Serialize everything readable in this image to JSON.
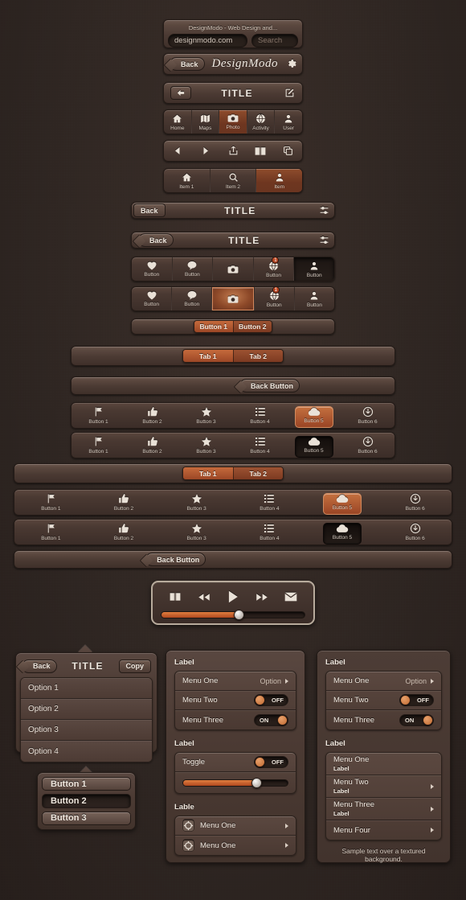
{
  "palette": {
    "background": "#2e2420",
    "bar_light": "#6b574d",
    "bar_dark": "#3f302a",
    "accent_orange": "#b0512c",
    "text": "#e8e0d8",
    "pressed_dark": "#241c19"
  },
  "browser_bar": {
    "page_title": "DesignModo - Web Design  and...",
    "url_value": "designmodo.com",
    "search_placeholder": "Search"
  },
  "logo_bar": {
    "back_label": "Back",
    "logo_text": "DesignModo",
    "gear_icon": "gear-icon"
  },
  "title_bar": {
    "back_icon": "arrow-left-icon",
    "title": "TITLE",
    "compose_icon": "compose-icon"
  },
  "tabbar_five": {
    "items": [
      {
        "label": "Home",
        "icon": "home-icon",
        "active": false
      },
      {
        "label": "Maps",
        "icon": "map-icon",
        "active": false
      },
      {
        "label": "Photo",
        "icon": "camera-icon",
        "active": true
      },
      {
        "label": "Activity",
        "icon": "globe-icon",
        "active": false
      },
      {
        "label": "User",
        "icon": "person-icon",
        "active": false
      }
    ]
  },
  "toolbar_icons": {
    "items": [
      {
        "icon": "triangle-left-icon"
      },
      {
        "icon": "triangle-right-icon"
      },
      {
        "icon": "share-icon"
      },
      {
        "icon": "book-icon"
      },
      {
        "icon": "copy-icon"
      }
    ]
  },
  "item_bar": {
    "items": [
      {
        "label": "Item 1",
        "icon": "home-icon",
        "active": false
      },
      {
        "label": "Item 2",
        "icon": "search-icon",
        "active": false
      },
      {
        "label": "Item",
        "icon": "person-icon",
        "active": true
      }
    ]
  },
  "navbar_flat": {
    "back_label": "Back",
    "title": "TITLE",
    "right_icon": "sliders-icon"
  },
  "navbar_arrow": {
    "back_label": "Back",
    "title": "TITLE",
    "right_icon": "sliders-icon"
  },
  "buttonbar_a": {
    "items": [
      {
        "label": "Button",
        "icon": "heart-icon",
        "state": "normal",
        "badge": ""
      },
      {
        "label": "Button",
        "icon": "comment-icon",
        "state": "normal",
        "badge": ""
      },
      {
        "label": "",
        "icon": "camera-icon",
        "state": "normal",
        "badge": ""
      },
      {
        "label": "Button",
        "icon": "globe-icon",
        "state": "normal",
        "badge": "1"
      },
      {
        "label": "Button",
        "icon": "person-icon",
        "state": "pressed",
        "badge": ""
      }
    ]
  },
  "buttonbar_b": {
    "items": [
      {
        "label": "Button",
        "icon": "heart-icon",
        "state": "normal",
        "badge": ""
      },
      {
        "label": "Button",
        "icon": "comment-icon",
        "state": "normal",
        "badge": ""
      },
      {
        "label": "",
        "icon": "camera-icon",
        "state": "active",
        "badge": ""
      },
      {
        "label": "Button",
        "icon": "globe-icon",
        "state": "normal",
        "badge": "1"
      },
      {
        "label": "Button",
        "icon": "person-icon",
        "state": "normal",
        "badge": ""
      }
    ]
  },
  "segmented_small": {
    "options": [
      {
        "label": "Button 1",
        "selected": true
      },
      {
        "label": "Button 2",
        "selected": false
      }
    ]
  },
  "segmented_tabs_narrow": {
    "options": [
      {
        "label": "Tab 1",
        "selected": true
      },
      {
        "label": "Tab 2",
        "selected": false
      }
    ]
  },
  "segmented_tabs_wide": {
    "options": [
      {
        "label": "Tab 1",
        "selected": true
      },
      {
        "label": "Tab 2",
        "selected": false
      }
    ]
  },
  "back_button_bar_narrow": {
    "label": "Back Button"
  },
  "back_button_bar_wide": {
    "label": "Back Button"
  },
  "toolbar_six_a": {
    "items": [
      {
        "label": "Button 1",
        "icon": "flag-icon",
        "state": "normal"
      },
      {
        "label": "Button 2",
        "icon": "thumbs-up-icon",
        "state": "normal"
      },
      {
        "label": "Button 3",
        "icon": "star-icon",
        "state": "normal"
      },
      {
        "label": "Button 4",
        "icon": "list-icon",
        "state": "normal"
      },
      {
        "label": "Button 5",
        "icon": "cloud-icon",
        "state": "active"
      },
      {
        "label": "Button 6",
        "icon": "download-icon",
        "state": "normal"
      }
    ]
  },
  "toolbar_six_b": {
    "items": [
      {
        "label": "Button 1",
        "icon": "flag-icon",
        "state": "normal"
      },
      {
        "label": "Button 2",
        "icon": "thumbs-up-icon",
        "state": "normal"
      },
      {
        "label": "Button 3",
        "icon": "star-icon",
        "state": "normal"
      },
      {
        "label": "Button 4",
        "icon": "list-icon",
        "state": "normal"
      },
      {
        "label": "Button 5",
        "icon": "cloud-icon",
        "state": "pressed"
      },
      {
        "label": "Button 6",
        "icon": "download-icon",
        "state": "normal"
      }
    ]
  },
  "toolbar_six_wide_a": {
    "items": [
      {
        "label": "Button 1",
        "icon": "flag-icon",
        "state": "normal"
      },
      {
        "label": "Button 2",
        "icon": "thumbs-up-icon",
        "state": "normal"
      },
      {
        "label": "Button 3",
        "icon": "star-icon",
        "state": "normal"
      },
      {
        "label": "Button 4",
        "icon": "list-icon",
        "state": "normal"
      },
      {
        "label": "Button 5",
        "icon": "cloud-icon",
        "state": "active"
      },
      {
        "label": "Button 6",
        "icon": "download-icon",
        "state": "normal"
      }
    ]
  },
  "toolbar_six_wide_b": {
    "items": [
      {
        "label": "Button 1",
        "icon": "flag-icon",
        "state": "normal"
      },
      {
        "label": "Button 2",
        "icon": "thumbs-up-icon",
        "state": "normal"
      },
      {
        "label": "Button 3",
        "icon": "star-icon",
        "state": "normal"
      },
      {
        "label": "Button 4",
        "icon": "list-icon",
        "state": "normal"
      },
      {
        "label": "Button 5",
        "icon": "cloud-icon",
        "state": "pressed"
      },
      {
        "label": "Button 6",
        "icon": "download-icon",
        "state": "normal"
      }
    ]
  },
  "media_player": {
    "controls": [
      {
        "icon": "book-icon"
      },
      {
        "icon": "rewind-icon"
      },
      {
        "icon": "play-icon"
      },
      {
        "icon": "fast-forward-icon"
      },
      {
        "icon": "mail-icon"
      }
    ],
    "progress_percent": 54
  },
  "popover_options": {
    "back_label": "Back",
    "title": "TITLE",
    "copy_label": "Copy",
    "options": [
      "Option 1",
      "Option 2",
      "Option 3",
      "Option 4"
    ]
  },
  "button_stack": {
    "buttons": [
      {
        "label": "Button 1",
        "state": "normal"
      },
      {
        "label": "Button 2",
        "state": "pressed"
      },
      {
        "label": "Button 3",
        "state": "normal"
      }
    ]
  },
  "settings_panel_middle": {
    "group1_label": "Label",
    "group1_rows": [
      {
        "key": "Menu One",
        "value": "Option",
        "type": "disclosure"
      },
      {
        "key": "Menu Two",
        "value": "OFF",
        "type": "toggle-off"
      },
      {
        "key": "Menu Three",
        "value": "ON",
        "type": "toggle-on"
      }
    ],
    "group2_label": "Label",
    "group2_toggle_key": "Toggle",
    "group2_toggle_value": "OFF",
    "group2_slider_percent": 70,
    "group3_label": "Lable",
    "group3_rows": [
      {
        "key": "Menu One",
        "icon": "settings-knob-icon"
      },
      {
        "key": "Menu One",
        "icon": "settings-knob-icon"
      }
    ]
  },
  "settings_panel_right": {
    "group1_label": "Label",
    "group1_rows": [
      {
        "key": "Menu One",
        "value": "Option",
        "type": "disclosure"
      },
      {
        "key": "Menu Two",
        "value": "OFF",
        "type": "toggle-off"
      },
      {
        "key": "Menu Three",
        "value": "ON",
        "type": "toggle-on"
      }
    ],
    "group2_label": "Label",
    "group2_rows": [
      {
        "key": "Menu One",
        "sub": "Label",
        "chevron": false
      },
      {
        "key": "Menu Two",
        "sub": "Label",
        "chevron": true
      },
      {
        "key": "Menu Three",
        "sub": "Label",
        "chevron": true
      },
      {
        "key": "Menu Four",
        "sub": "",
        "chevron": true
      }
    ],
    "footer_text": "Sample text over a textured background."
  }
}
